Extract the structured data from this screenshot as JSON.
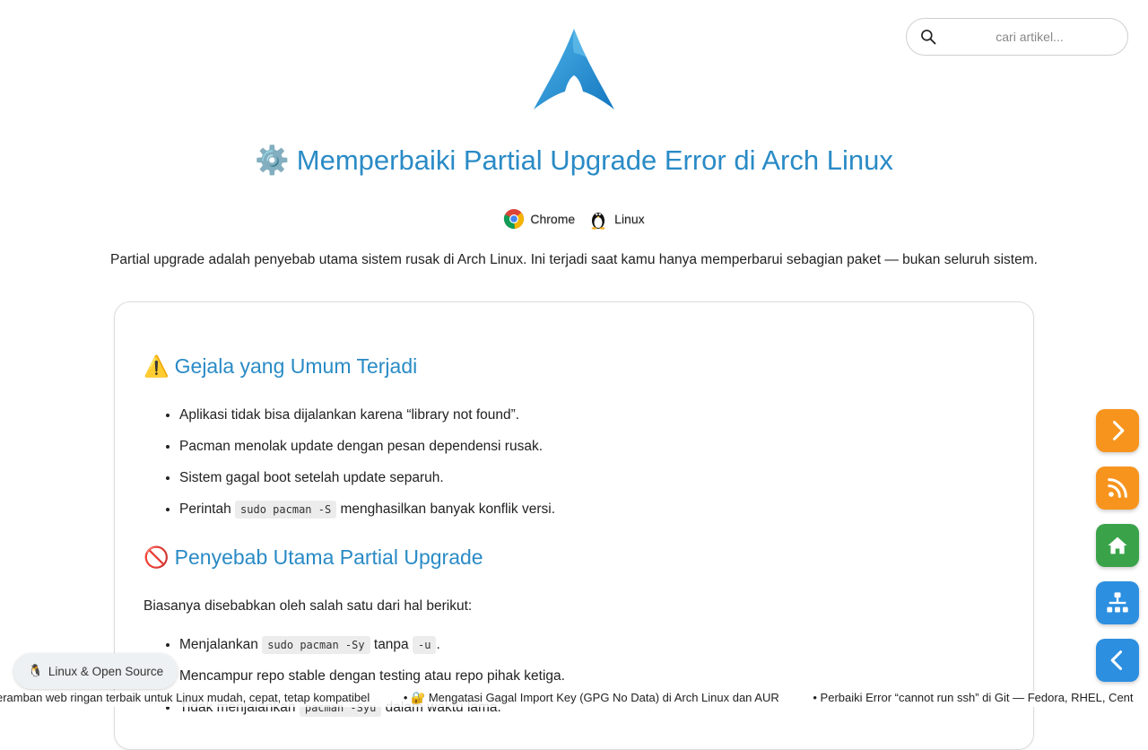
{
  "search": {
    "placeholder": "cari artikel..."
  },
  "header": {
    "title": "Memperbaiki Partial Upgrade Error di Arch Linux",
    "title_icon": "⚙️"
  },
  "badges": [
    {
      "label": "Chrome",
      "icon": "chrome-icon"
    },
    {
      "label": "Linux",
      "icon": "tux-icon"
    }
  ],
  "intro": "Partial upgrade adalah penyebab utama sistem rusak di Arch Linux. Ini terjadi saat kamu hanya memperbarui sebagian paket — bukan seluruh sistem.",
  "section1": {
    "emoji": "⚠️",
    "title": "Gejala yang Umum Terjadi",
    "items": [
      "Aplikasi tidak bisa dijalankan karena “library not found”.",
      "Pacman menolak update dengan pesan dependensi rusak.",
      "Sistem gagal boot setelah update separuh.",
      {
        "before": "Perintah ",
        "code": "sudo pacman -S",
        "after": " menghasilkan banyak konflik versi."
      }
    ]
  },
  "section2": {
    "emoji": "🚫",
    "title": "Penyebab Utama Partial Upgrade",
    "intro": "Biasanya disebabkan oleh salah satu dari hal berikut:",
    "items": [
      {
        "before": "Menjalankan ",
        "code": "sudo pacman -Sy",
        "middle": " tanpa ",
        "code2": "-u",
        "after": "."
      },
      "Mencampur repo stable dengan testing atau repo pihak ketiga.",
      {
        "before": "Tidak menjalankan ",
        "code": "pacman -Syu",
        "after": " dalam waktu lama."
      }
    ]
  },
  "fabs": [
    {
      "name": "next-button",
      "icon": "chevron-right-icon",
      "color": "#f7941d"
    },
    {
      "name": "rss-button",
      "icon": "rss-icon",
      "color": "#f7941d"
    },
    {
      "name": "home-button",
      "icon": "home-icon",
      "color": "#3aa34a"
    },
    {
      "name": "sitemap-button",
      "icon": "sitemap-icon",
      "color": "#2c8fe0"
    },
    {
      "name": "back-button",
      "icon": "chevron-left-icon",
      "color": "#2c8fe0"
    }
  ],
  "pill": {
    "emoji": "🐧",
    "label": "Linux & Open Source"
  },
  "ticker": [
    "eramban web ringan terbaik untuk Linux mudah, cepat, tetap kompatibel",
    "• 🔐 Mengatasi Gagal Import Key (GPG No Data) di Arch Linux dan AUR",
    "• Perbaiki Error “cannot run ssh” di Git — Fedora, RHEL, Cent"
  ]
}
